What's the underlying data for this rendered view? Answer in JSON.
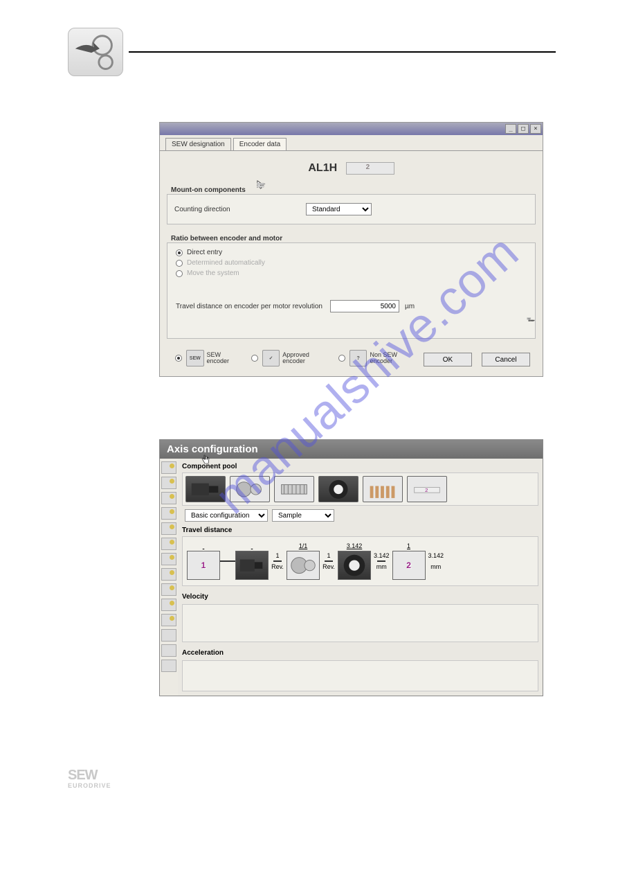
{
  "header": {},
  "watermark": "manualshive.com",
  "dialog": {
    "tabs": {
      "designation": "SEW designation",
      "encoder": "Encoder data"
    },
    "title": "AL1H",
    "group_mount": {
      "label": "Mount-on components",
      "counting_direction_label": "Counting direction",
      "counting_direction_value": "Standard"
    },
    "group_ratio": {
      "label": "Ratio between encoder and motor",
      "opt_direct": "Direct entry",
      "opt_auto": "Determined automatically",
      "opt_move": "Move the system",
      "travel_label": "Travel distance on encoder per motor revolution",
      "travel_value": "5000",
      "travel_unit": "µm"
    },
    "encoder_types": {
      "sew": "SEW encoder",
      "approved": "Approved encoder",
      "nonsew": "Non SEW encoder"
    },
    "buttons": {
      "ok": "OK",
      "cancel": "Cancel"
    },
    "winbtns": {
      "min": "_",
      "max": "□",
      "close": "×"
    }
  },
  "axis": {
    "title": "Axis configuration",
    "pool_label": "Component pool",
    "basic_config_label": "Basic configuration",
    "sample_label": "Sample",
    "travel_label": "Travel distance",
    "velocity_label": "Velocity",
    "accel_label": "Acceleration",
    "chain": {
      "num1": "1",
      "ratio1": "1",
      "rev": "Rev.",
      "gear_ratio": "1/1",
      "ratio2": "1",
      "drum_val": "3.142",
      "drum_out": "3.142",
      "mm": "mm",
      "scale_top": "1",
      "num2": "2",
      "final": "3.142"
    }
  },
  "footer": {
    "brand_top": "SEW",
    "brand_bottom": "EURODRIVE"
  }
}
